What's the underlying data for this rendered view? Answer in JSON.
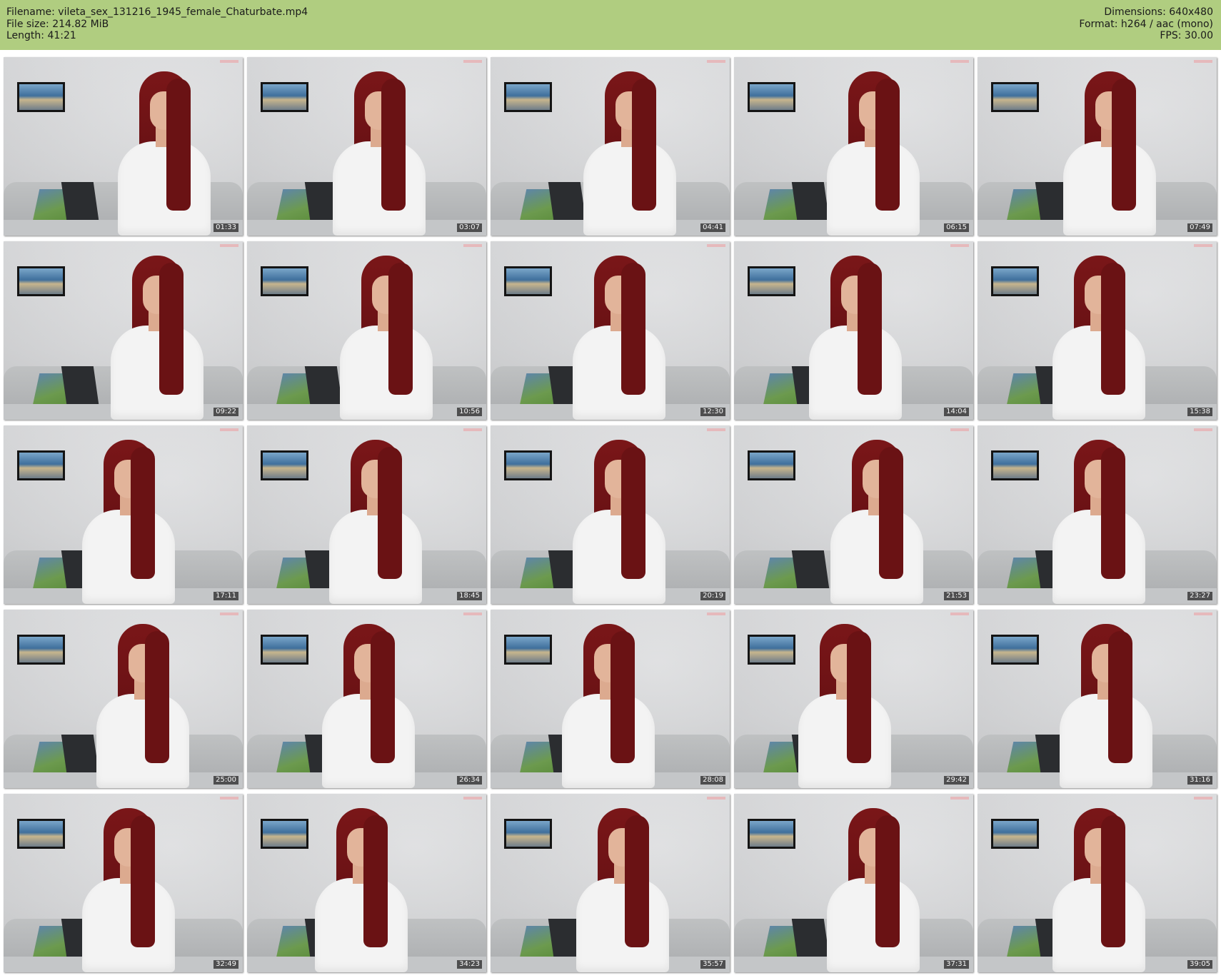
{
  "header": {
    "filename_line": "Filename: vileta_sex_131216_1945_female_Chaturbate.mp4",
    "filesize_line": "File size: 214.82 MiB",
    "length_line": "Length: 41:21",
    "dimensions_line": "Dimensions: 640x480",
    "format_line": "Format: h264 / aac (mono)",
    "fps_line": "FPS: 30.00"
  },
  "thumbnails": [
    {
      "time": "01:33"
    },
    {
      "time": "03:07"
    },
    {
      "time": "04:41"
    },
    {
      "time": "06:15"
    },
    {
      "time": "07:49"
    },
    {
      "time": "09:22"
    },
    {
      "time": "10:56"
    },
    {
      "time": "12:30"
    },
    {
      "time": "14:04"
    },
    {
      "time": "15:38"
    },
    {
      "time": "17:11"
    },
    {
      "time": "18:45"
    },
    {
      "time": "20:19"
    },
    {
      "time": "21:53"
    },
    {
      "time": "23:27"
    },
    {
      "time": "25:00"
    },
    {
      "time": "26:34"
    },
    {
      "time": "28:08"
    },
    {
      "time": "29:42"
    },
    {
      "time": "31:16"
    },
    {
      "time": "32:49"
    },
    {
      "time": "34:23"
    },
    {
      "time": "35:57"
    },
    {
      "time": "37:31"
    },
    {
      "time": "39:05"
    }
  ],
  "colors": {
    "header_bg": "#b0cd80",
    "hair": "#6a1214",
    "shirt": "#f3f3f3"
  }
}
